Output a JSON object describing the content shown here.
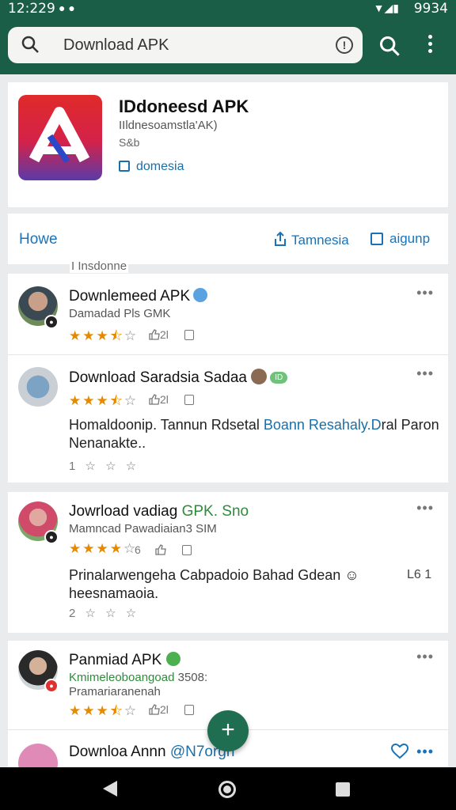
{
  "status": {
    "time": "12:229",
    "battery": "9934"
  },
  "search": {
    "query": "Download APK"
  },
  "app": {
    "title": "IDdoneesd APK",
    "subtitle": "IIldnesoamstla'AK)",
    "size": "S&b",
    "link_label": "domesia"
  },
  "tabs": {
    "home": "Howe",
    "share": "Tamnesia",
    "signup": "aigunp"
  },
  "section_label": "I Insdonne",
  "reviews": [
    {
      "name": "Downlemeed APK",
      "meta": "Damadad Pls GMK",
      "rating": 3.5,
      "likes": "2l",
      "text": "",
      "link": ""
    },
    {
      "name": "Download Saradsia Sadaa",
      "meta": "",
      "rating": 3.5,
      "likes": "2l",
      "chip": "ID",
      "text_a": "Homaldoonip. Tannun Rdsetal ",
      "link": "Boann Resahaly.D",
      "text_b": "ral Paron Nenanakte..",
      "count": "1"
    },
    {
      "name": "Jowrload vadiag ",
      "name_green": "GPK. Sno",
      "meta": "Mamncad Pawadiaian3 SIM",
      "rating": 4,
      "likes": "6",
      "text": "Prinalarwengeha Cabpadoio Bahad Gdean ☺",
      "text2": "heesnamaoia.",
      "count": "2",
      "side": "L6 1"
    },
    {
      "name": "Panmiad APK",
      "meta_green": "Kmimeleoboangoad",
      "meta_num": "3508:",
      "meta2": "Pramariaranenah",
      "rating": 3.5,
      "likes": "2l"
    },
    {
      "name": "Downloa Annn ",
      "name_blue": "@N7orgn"
    }
  ]
}
